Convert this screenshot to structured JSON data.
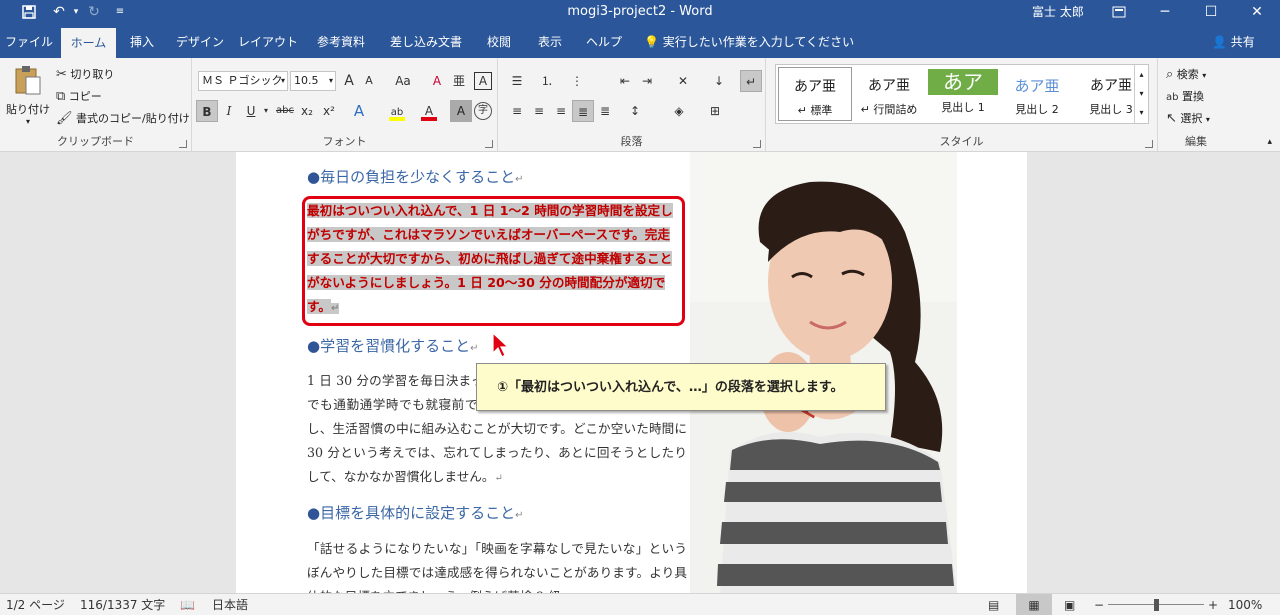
{
  "titlebar": {
    "save_icon": "save-icon",
    "undo_icon": "undo-icon",
    "redo_icon": "redo-icon",
    "customize_icon": "customize-quick-access-icon",
    "title": "mogi3-project2  -  Word",
    "user": "富士 太郎",
    "win_buttons": [
      "ribbon-display-icon",
      "minimize-icon",
      "maximize-icon",
      "close-icon"
    ]
  },
  "tabs": [
    {
      "label": "ファイル"
    },
    {
      "label": "ホーム",
      "active": true
    },
    {
      "label": "挿入"
    },
    {
      "label": "デザイン"
    },
    {
      "label": "レイアウト"
    },
    {
      "label": "参考資料"
    },
    {
      "label": "差し込み文書"
    },
    {
      "label": "校閲"
    },
    {
      "label": "表示"
    },
    {
      "label": "ヘルプ"
    }
  ],
  "tellme": "実行したい作業を入力してください",
  "share": "共有",
  "ribbon": {
    "clipboard": {
      "label": "クリップボード",
      "paste": "貼り付け",
      "cut": "切り取り",
      "copy": "コピー",
      "format_painter": "書式のコピー/貼り付け"
    },
    "font": {
      "label": "フォント",
      "font_name": "ＭＳ Ｐゴシック",
      "font_size": "10.5",
      "bold": "B",
      "italic": "I",
      "underline": "U",
      "strike": "abc",
      "sub": "x₂",
      "sup": "x²",
      "grow": "A",
      "shrink": "A",
      "case": "Aa",
      "clear": "A",
      "phonetic": "亜",
      "border_char": "A",
      "effects": "A",
      "highlight": "ab",
      "font_color": "A",
      "shading": "A",
      "enclose": "字",
      "highlight_color": "#ffff00",
      "font_color_value": "#e00012"
    },
    "paragraph": {
      "label": "段落"
    },
    "styles": {
      "label": "スタイル",
      "items": [
        {
          "preview": "あア亜",
          "name": "標準",
          "prefix": "↵ "
        },
        {
          "preview": "あア亜",
          "name": "行間詰め",
          "prefix": "↵ "
        },
        {
          "preview": "あア",
          "name": "見出し 1",
          "prefix": ""
        },
        {
          "preview": "あア亜",
          "name": "見出し 2",
          "prefix": ""
        },
        {
          "preview": "あア亜",
          "name": "見出し 3",
          "prefix": ""
        }
      ]
    },
    "editing": {
      "label": "編集",
      "find": "検索",
      "replace": "置換",
      "select": "選択"
    }
  },
  "document": {
    "heading1": "毎日の負担を少なくすること",
    "selected_para": "最初はついつい入れ込んで、1 日 1～2 時間の学習時間を設定しがちですが、これはマラソンでいえばオーバーペースです。完走することが大切ですから、初めに飛ばし過ぎて途中棄権することがないようにしましょう。1 日 20～30 分の時間配分が適切です。",
    "heading2": "学習を習慣化すること",
    "para2": "1 日 30 分の学習を毎日決まった時間に行うようにしましょう。朝でも通勤通学時でも就寝前でも構いません。決まった時間に学習し、生活習慣の中に組み込むことが大切です。どこか空いた時間に 30 分という考えでは、忘れてしまったり、あとに回そうとしたりして、なかなか習慣化しません。",
    "heading3": "目標を具体的に設定すること",
    "para3": "「話せるようになりたいな」「映画を字幕なしで見たいな」というぼんやりした目標では達成感を得られないことがあります。より具体的な目標を立てましょう。例えば英検 2 級",
    "pilcrow": "↵"
  },
  "callout": "①「最初はついつい入れ込んで、…」の段落を選択します。",
  "status": {
    "page": "1/2 ページ",
    "words": "116/1337 文字",
    "lang": "日本語",
    "zoom": "100%",
    "zoom_level": 1.0
  }
}
